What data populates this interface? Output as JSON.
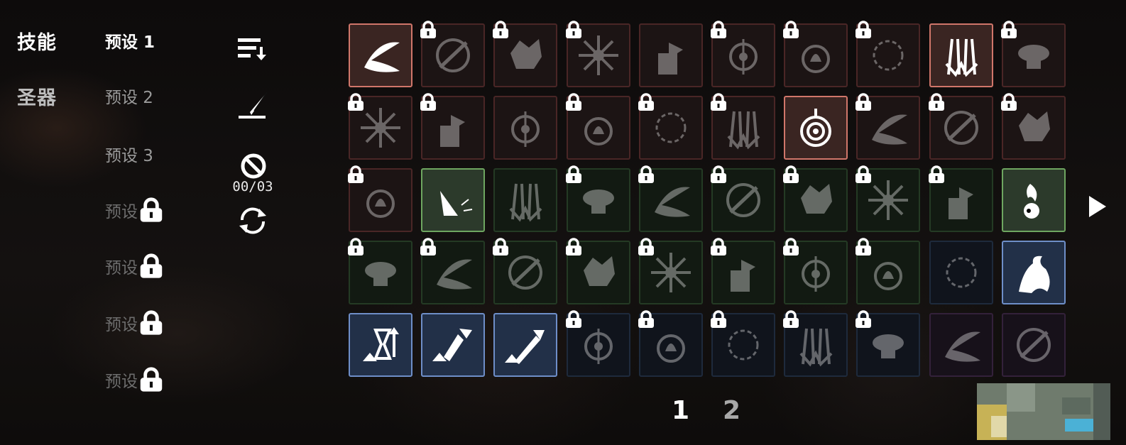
{
  "categories": [
    {
      "label": "技能",
      "active": true
    },
    {
      "label": "圣器",
      "active": false
    }
  ],
  "presets": [
    {
      "label": "预设 1",
      "state": "active"
    },
    {
      "label": "预设 2",
      "state": "normal"
    },
    {
      "label": "预设 3",
      "state": "normal"
    },
    {
      "label": "预设",
      "state": "locked"
    },
    {
      "label": "预设",
      "state": "locked"
    },
    {
      "label": "预设",
      "state": "locked"
    },
    {
      "label": "预设",
      "state": "locked"
    }
  ],
  "tools": {
    "sort_icon": "sort-descending-icon",
    "edit_icon": "quill-pen-icon",
    "disable_icon": "prohibited-icon",
    "counter": "00/03",
    "refresh_icon": "refresh-cycle-icon"
  },
  "skills": [
    [
      "red-on",
      "red-lock",
      "red-lock",
      "red-lock",
      "red",
      "red-lock",
      "red-lock",
      "red-lock",
      "red-on",
      "red-lock"
    ],
    [
      "red-lock",
      "red-lock",
      "red",
      "red-lock",
      "red-lock",
      "red-lock",
      "red-on",
      "red-lock",
      "red-lock",
      "red-lock"
    ],
    [
      "red-lock",
      "green-on",
      "green",
      "green-lock",
      "green-lock",
      "green-lock",
      "green-lock",
      "green-lock",
      "green-lock",
      "green-on"
    ],
    [
      "green-lock",
      "green-lock",
      "green-lock",
      "green-lock",
      "green-lock",
      "green-lock",
      "green-lock",
      "green-lock",
      "blue",
      "blue-on"
    ],
    [
      "blue-on",
      "blue-on",
      "blue-on",
      "blue-lock",
      "blue-lock",
      "blue-lock",
      "blue-lock",
      "blue-lock",
      "purple",
      "purple"
    ]
  ],
  "pagination": {
    "current": "1",
    "next": "2"
  },
  "colors": {
    "red": "#d0766a",
    "green": "#6ea660",
    "blue": "#6e8ec8",
    "purple": "#7a4a8a"
  }
}
